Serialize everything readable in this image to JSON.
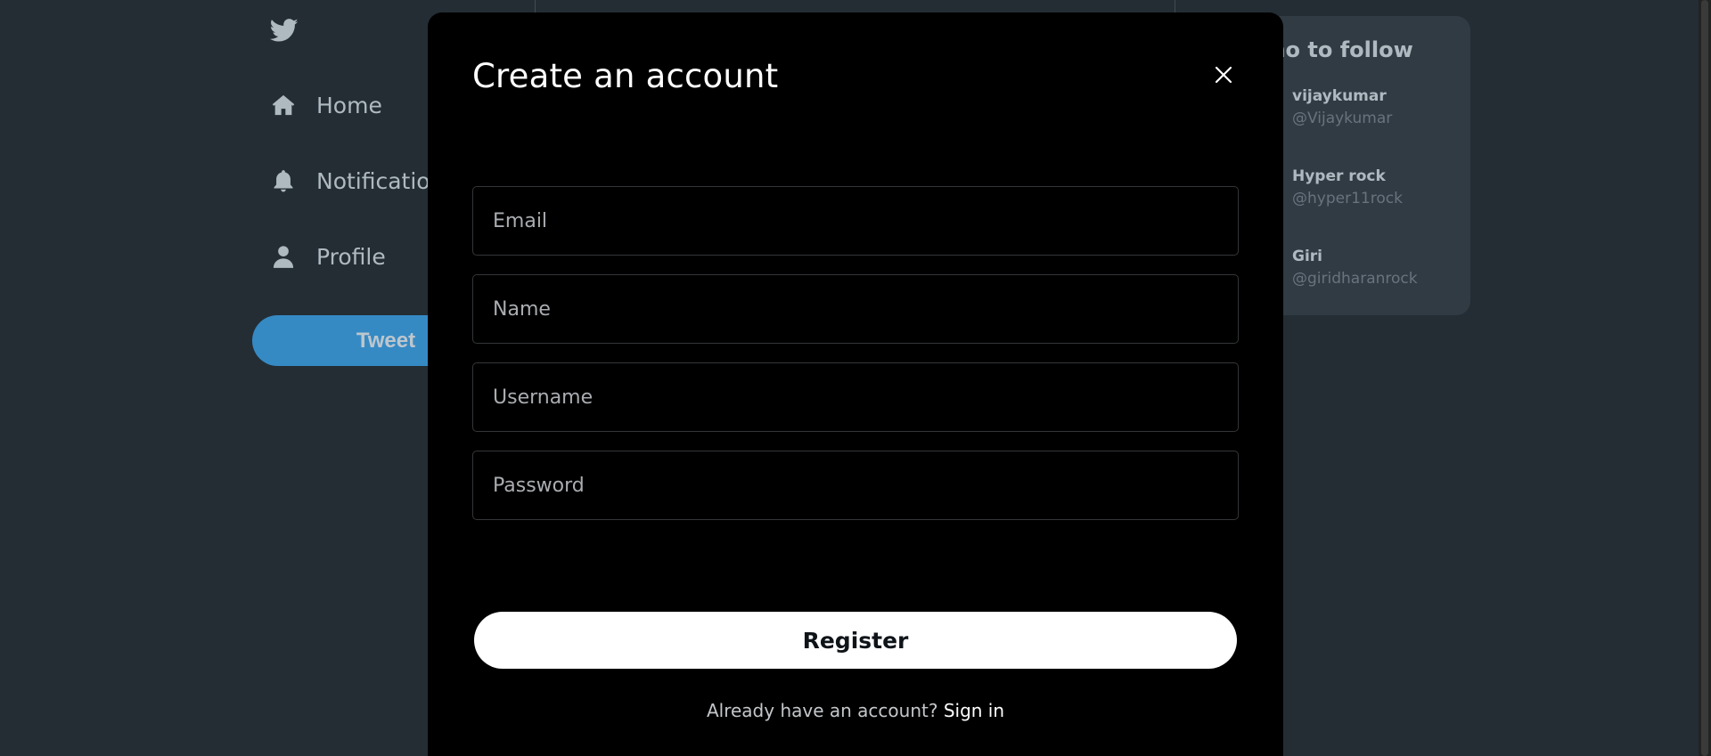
{
  "sidebar": {
    "logo_icon": "twitter-bird-icon",
    "items": [
      {
        "label": "Home",
        "icon": "home-icon"
      },
      {
        "label": "Notifications",
        "icon": "bell-icon"
      },
      {
        "label": "Profile",
        "icon": "person-icon"
      }
    ],
    "tweet_label": "Tweet"
  },
  "who_to_follow": {
    "title": "Who to follow",
    "users": [
      {
        "name": "vijaykumar",
        "handle": "@Vijaykumar"
      },
      {
        "name": "Hyper rock",
        "handle": "@hyper11rock"
      },
      {
        "name": "Giri",
        "handle": "@giridharanrock"
      }
    ]
  },
  "modal": {
    "title": "Create an account",
    "close_icon": "close-icon",
    "fields": {
      "email_placeholder": "Email",
      "name_placeholder": "Name",
      "username_placeholder": "Username",
      "password_placeholder": "Password"
    },
    "register_label": "Register",
    "signin_prompt": "Already have an account?",
    "signin_link": "Sign in"
  },
  "colors": {
    "accent": "#1d9bf0",
    "background": "#000000",
    "overlay": "#5b7083"
  }
}
